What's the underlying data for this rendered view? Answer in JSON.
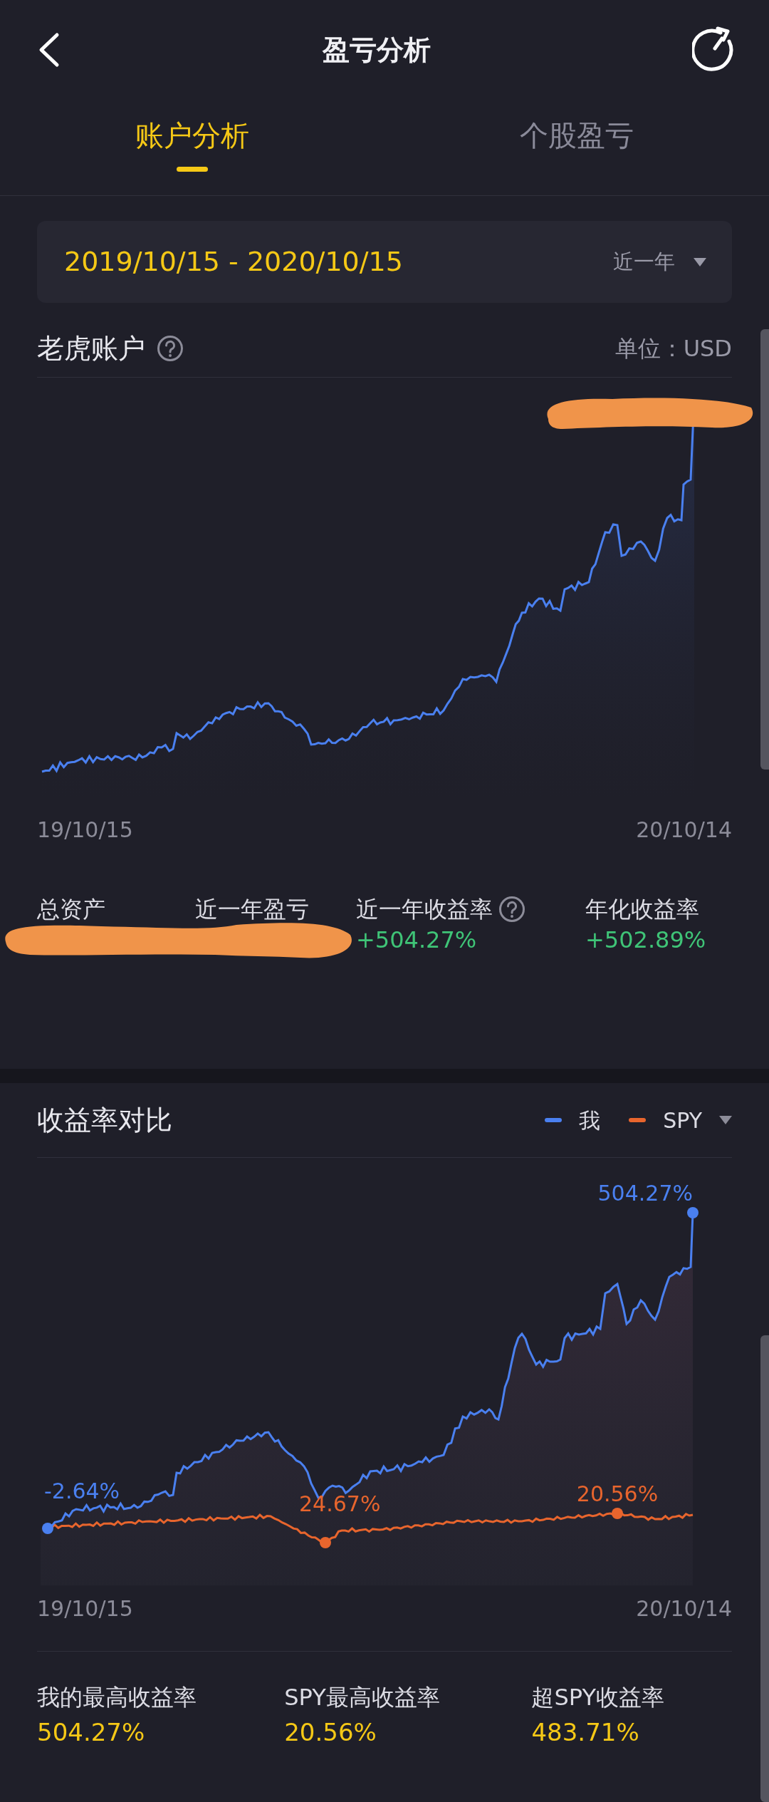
{
  "header": {
    "title": "盈亏分析"
  },
  "tabs": [
    {
      "label": "账户分析",
      "selected": true
    },
    {
      "label": "个股盈亏",
      "selected": false
    }
  ],
  "date_range": {
    "value": "2019/10/15 - 2020/10/15",
    "period": "近一年"
  },
  "account": {
    "title": "老虎账户",
    "unit": "单位：USD",
    "x_start": "19/10/15",
    "x_end": "20/10/14",
    "chart_redacted": true,
    "stats_redacted": true,
    "stats": [
      {
        "label": "总资产",
        "help": false
      },
      {
        "label": "近一年盈亏",
        "help": false
      },
      {
        "label": "近一年收益率",
        "help": true,
        "value": "+504.27%"
      },
      {
        "label": "年化收益率",
        "help": false,
        "value": "+502.89%"
      }
    ]
  },
  "comparison": {
    "title": "收益率对比",
    "legend": [
      {
        "label": "我",
        "color": "#4a80f0"
      },
      {
        "label": "SPY",
        "color": "#e8652d"
      }
    ],
    "annotations": [
      {
        "text": "-2.64%",
        "color": "#4a80f0"
      },
      {
        "text": "504.27%",
        "color": "#4a80f0"
      },
      {
        "text": "24.67%",
        "color": "#e8652d"
      },
      {
        "text": "20.56%",
        "color": "#e8652d"
      }
    ],
    "x_start": "19/10/15",
    "x_end": "20/10/14",
    "stats": [
      {
        "label": "我的最高收益率",
        "value": "504.27%"
      },
      {
        "label": "SPY最高收益率",
        "value": "20.56%"
      },
      {
        "label": "超SPY收益率",
        "value": "483.71%"
      }
    ]
  }
}
